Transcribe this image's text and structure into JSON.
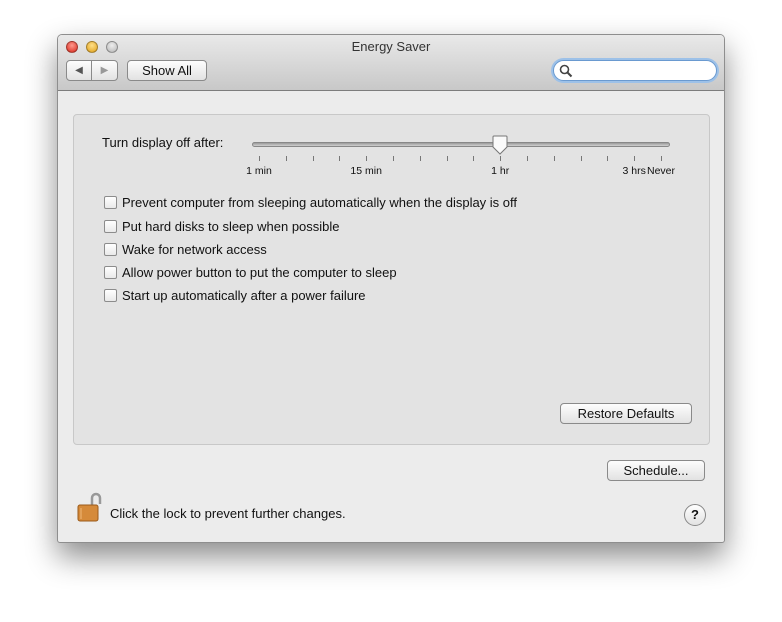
{
  "window": {
    "title": "Energy Saver"
  },
  "toolbar": {
    "back_icon": "back-arrow-icon",
    "forward_icon": "forward-arrow-icon",
    "show_all_label": "Show All",
    "search_placeholder": ""
  },
  "slider": {
    "label": "Turn display off after:",
    "value": "1 hr",
    "value_fraction": 0.6,
    "tick_count": 16,
    "tick_labels": [
      {
        "text": "1 min",
        "tick": 0
      },
      {
        "text": "15 min",
        "tick": 4
      },
      {
        "text": "1 hr",
        "tick": 9
      },
      {
        "text": "3 hrs",
        "tick": 14
      },
      {
        "text": "Never",
        "tick": 15
      }
    ]
  },
  "options": [
    {
      "label": "Prevent computer from sleeping automatically when the display is off",
      "checked": false
    },
    {
      "label": "Put hard disks to sleep when possible",
      "checked": false
    },
    {
      "label": "Wake for network access",
      "checked": false
    },
    {
      "label": "Allow power button to put the computer to sleep",
      "checked": false
    },
    {
      "label": "Start up automatically after a power failure",
      "checked": false
    }
  ],
  "restore_defaults_label": "Restore Defaults",
  "schedule_label": "Schedule...",
  "lock_text": "Click the lock to prevent further changes.",
  "help_label": "?"
}
